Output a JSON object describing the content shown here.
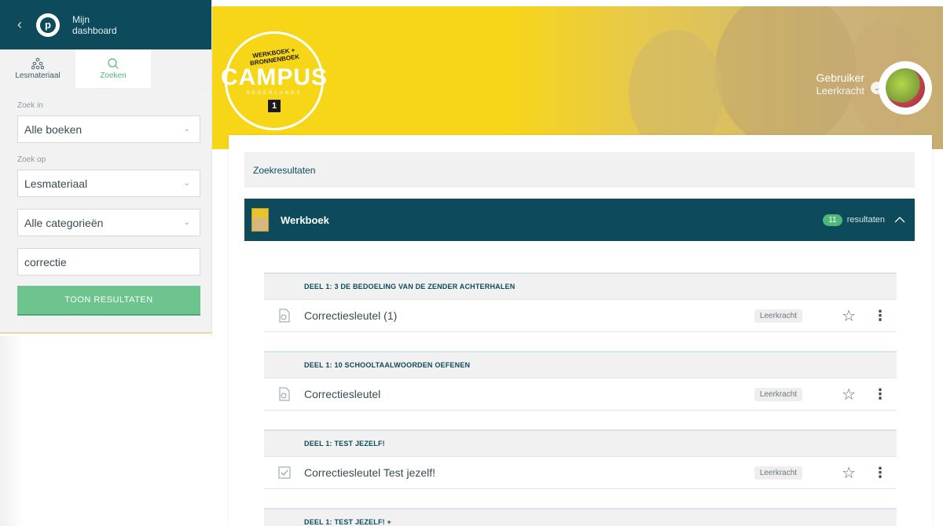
{
  "sidebar": {
    "back_icon": "chevron-left-icon",
    "logo": "brand-logo",
    "title_line1": "Mijn",
    "title_line2": "dashboard",
    "tabs": [
      {
        "label": "Lesmateriaal",
        "icon": "hierarchy-icon"
      },
      {
        "label": "Zoeken",
        "icon": "search-icon"
      }
    ],
    "search_in_label": "Zoek in",
    "search_in_value": "Alle boeken",
    "search_on_label": "Zoek op",
    "search_on_value": "Lesmateriaal",
    "category_value": "Alle categorieën",
    "query_value": "correctie",
    "submit_label": "TOON RESULTATEN"
  },
  "header": {
    "badge_top": "WERKBOEK + BRONNENBOEK",
    "badge_main": "CAMPUS",
    "badge_sub": "NEDERLANDS",
    "badge_num": "1",
    "user_name": "Gebruiker",
    "user_role": "Leerkracht"
  },
  "main": {
    "results_title": "Zoekresultaten",
    "book_title": "Werkboek",
    "result_count": "11",
    "result_label": "resultaten",
    "sections": [
      {
        "title": "DEEL 1: 3 DE BEDOELING VAN DE ZENDER ACHTERHALEN",
        "item": "Correctiesleutel (1)",
        "badge": "Leerkracht",
        "icon": "document-icon"
      },
      {
        "title": "DEEL 1: 10 SCHOOLTAALWOORDEN OEFENEN",
        "item": "Correctiesleutel",
        "badge": "Leerkracht",
        "icon": "document-icon"
      },
      {
        "title": "DEEL 1: TEST JEZELF!",
        "item": "Correctiesleutel Test jezelf!",
        "badge": "Leerkracht",
        "icon": "checkbox-icon"
      },
      {
        "title": "DEEL 1: TEST JEZELF! +"
      }
    ]
  },
  "colors": {
    "primary": "#0d4a5c",
    "accent_green": "#4fb878",
    "header_yellow": "#f7d617"
  }
}
